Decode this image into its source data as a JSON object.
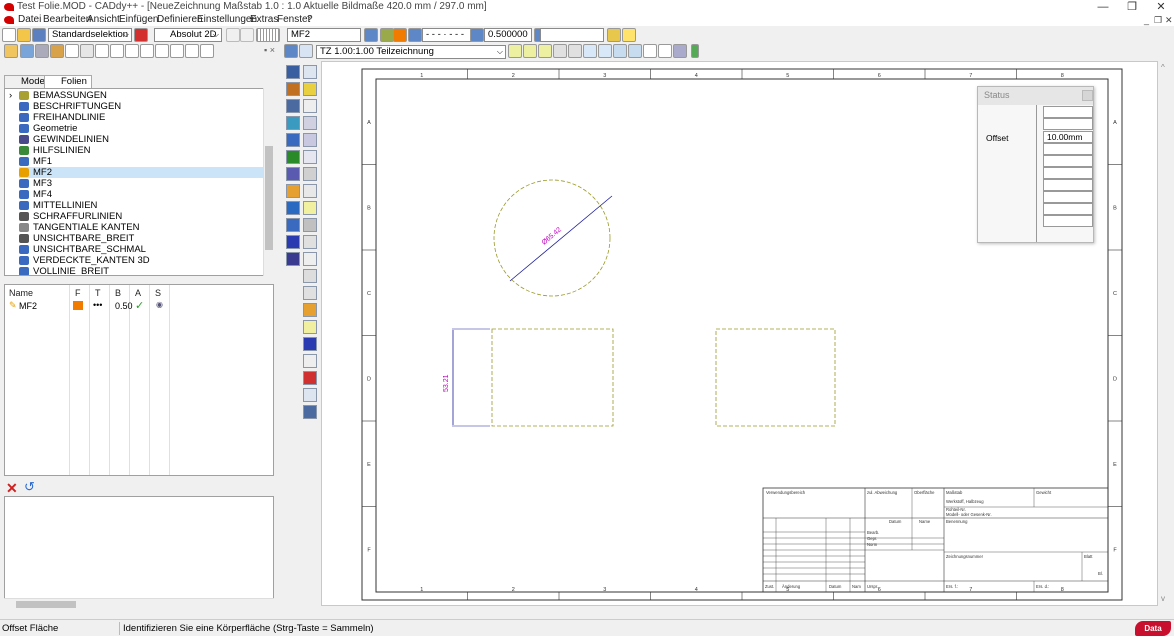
{
  "window": {
    "title": "Test Folie.MOD  -  CADdy++ - [NeueZeichnung   Maßstab 1.0 : 1.0   Aktuelle Bildmaße 420.0 mm / 297.0 mm]",
    "minimize_glyph": "—",
    "maximize_glyph": "❐",
    "close_glyph": "✕"
  },
  "menu": {
    "items": [
      "Datei",
      "Bearbeiten",
      "Ansicht",
      "Einfügen",
      "Definieren",
      "Einstellungen",
      "Extras",
      "Fenster",
      "?"
    ],
    "mdi_glyphs": [
      "_",
      "❐",
      "✕"
    ]
  },
  "toolbar": {
    "selection_mode": "Standardselektion",
    "coord_mode": "Absolut 2D",
    "layer": "MF2",
    "line_width": "0.500000",
    "view_label": "TZ 1.00:1.00 Teilzeichnung",
    "linetype_preview": "- - - · - - -"
  },
  "panel": {
    "tabs": [
      "Modell",
      "Folien"
    ],
    "active_tab": "Folien",
    "layers": [
      {
        "label": "BEMASSUNGEN",
        "icon": "dimension-icon",
        "expander": "›"
      },
      {
        "label": "BESCHRIFTUNGEN",
        "icon": "text-icon"
      },
      {
        "label": "FREIHANDLINIE",
        "icon": "layer-icon"
      },
      {
        "label": "Geometrie",
        "icon": "layer-icon"
      },
      {
        "label": "GEWINDELINIEN",
        "icon": "thread-icon"
      },
      {
        "label": "HILFSLINIEN",
        "icon": "helpline-icon"
      },
      {
        "label": "MF1",
        "icon": "layer-icon"
      },
      {
        "label": "MF2",
        "icon": "pencil-icon",
        "selected": true
      },
      {
        "label": "MF3",
        "icon": "layer-icon"
      },
      {
        "label": "MF4",
        "icon": "layer-icon"
      },
      {
        "label": "MITTELLINIEN",
        "icon": "centerline-icon"
      },
      {
        "label": "SCHRAFFURLINIEN",
        "icon": "hatch-icon"
      },
      {
        "label": "TANGENTIALE KANTEN",
        "icon": "tangent-icon"
      },
      {
        "label": "UNSICHTBARE_BREIT",
        "icon": "hidden-icon"
      },
      {
        "label": "UNSICHTBARE_SCHMAL",
        "icon": "layer-icon"
      },
      {
        "label": "VERDECKTE_KANTEN 3D",
        "icon": "cube-icon"
      },
      {
        "label": "VOLLINIE_BREIT",
        "icon": "layer-icon"
      }
    ],
    "prop_headers": [
      "Name",
      "F",
      "T",
      "B",
      "A",
      "S"
    ],
    "prop_row": {
      "name": "MF2",
      "color": "#f07b00",
      "linetype": "•••",
      "width": "0.50",
      "visible": "✓",
      "lock": "👁"
    }
  },
  "status_panel": {
    "title": "Status",
    "offset_label": "Offset",
    "offset_value": "10.00mm"
  },
  "drawing": {
    "col_labels": [
      "1",
      "2",
      "3",
      "4",
      "5",
      "6",
      "7",
      "8"
    ],
    "row_labels": [
      "A",
      "B",
      "C",
      "D",
      "E",
      "F"
    ],
    "circle_dim": "Ø65.42",
    "vert_dim": "53.21",
    "accent_line": "#9a9a2a",
    "dim_color": "#c000c0",
    "dim_line_color": "#1a1a9a",
    "title_block": {
      "verwendungsbereich": "Verwendungsbereich",
      "zul_abweichung": "zul. Abweichung",
      "oberflaeche": "Oberfläche",
      "massstab": "Maßstab",
      "gewicht": "Gewicht",
      "werkstoff": "Werkstoff, Halbzeug",
      "rohteil": "Rohteil-Nr.",
      "modell": "Modell- oder Gesenk-Nr.",
      "datum": "Datum",
      "name": "Name",
      "benennung": "Benennung",
      "bearb": "Bearb.",
      "gepr": "Gepr.",
      "norm": "Norm",
      "zeichnungsnummer": "Zeichnungsnummer",
      "blatt": "Blatt",
      "bl": "Bl.",
      "zust": "Zust.",
      "aenderung": "Änderung",
      "datum2": "Datum",
      "name2": "Nam",
      "urspr": "Urspr.",
      "ers_f": "Ers. f.:",
      "ers_d": "Ers. d.:"
    }
  },
  "statusbar": {
    "mode": "Offset Fläche",
    "hint": "Identifizieren Sie eine Körperfläche (Strg-Taste = Sammeln)",
    "brand": "Data Solid"
  }
}
